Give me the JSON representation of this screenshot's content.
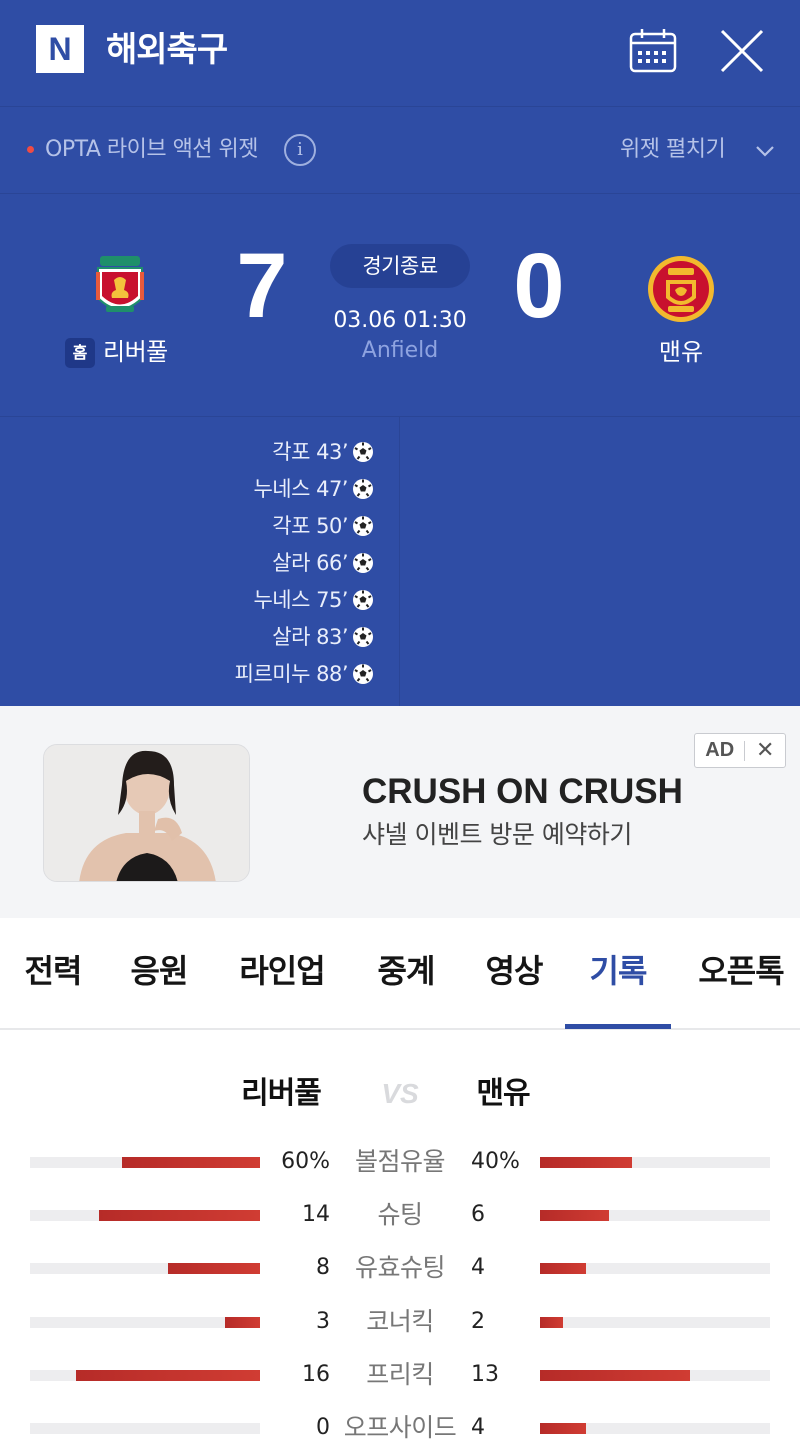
{
  "header": {
    "logo_letter": "N",
    "title": "해외축구"
  },
  "widget": {
    "opta_label": "OPTA 라이브 액션 위젯",
    "info_symbol": "i",
    "expand_label": "위젯 펼치기"
  },
  "match": {
    "status": "경기종료",
    "datetime": "03.06 01:30",
    "venue": "Anfield",
    "home": {
      "badge": "홈",
      "name": "리버풀",
      "score": "7"
    },
    "away": {
      "name": "맨유",
      "score": "0"
    }
  },
  "scorers": [
    {
      "text": "각포 43’"
    },
    {
      "text": "누네스 47’"
    },
    {
      "text": "각포 50’"
    },
    {
      "text": "살라 66’"
    },
    {
      "text": "누네스 75’"
    },
    {
      "text": "살라 83’"
    },
    {
      "text": "피르미누 88’"
    }
  ],
  "ad": {
    "title": "CRUSH ON CRUSH",
    "subtitle": "샤넬 이벤트 방문 예약하기",
    "badge_label": "AD",
    "close_symbol": "✕"
  },
  "tabs": [
    {
      "label": "전력"
    },
    {
      "label": "응원"
    },
    {
      "label": "라인업"
    },
    {
      "label": "중계"
    },
    {
      "label": "영상"
    },
    {
      "label": "기록"
    },
    {
      "label": "오픈톡"
    }
  ],
  "active_tab": "기록",
  "stats": {
    "home_name": "리버풀",
    "vs": "VS",
    "away_name": "맨유",
    "rows": [
      {
        "label": "볼점유율",
        "home": "60%",
        "away": "40%",
        "home_ratio": 0.6,
        "away_ratio": 0.4
      },
      {
        "label": "슈팅",
        "home": "14",
        "away": "6",
        "home_ratio": 0.7,
        "away_ratio": 0.3
      },
      {
        "label": "유효슈팅",
        "home": "8",
        "away": "4",
        "home_ratio": 0.4,
        "away_ratio": 0.2
      },
      {
        "label": "코너킥",
        "home": "3",
        "away": "2",
        "home_ratio": 0.15,
        "away_ratio": 0.1
      },
      {
        "label": "프리킥",
        "home": "16",
        "away": "13",
        "home_ratio": 0.8,
        "away_ratio": 0.65
      },
      {
        "label": "오프사이드",
        "home": "0",
        "away": "4",
        "home_ratio": 0.0,
        "away_ratio": 0.2
      }
    ]
  },
  "colors": {
    "header_blue": "#2f4da5",
    "live_red": "#f04b43",
    "stat_bar_red": "#c0322d",
    "active_tab": "#2f4da5"
  },
  "icons": {
    "calendar": "calendar-icon",
    "close": "close-icon",
    "info": "info-icon",
    "chevron": "chevron-down-icon",
    "goal": "soccer-ball-icon"
  }
}
